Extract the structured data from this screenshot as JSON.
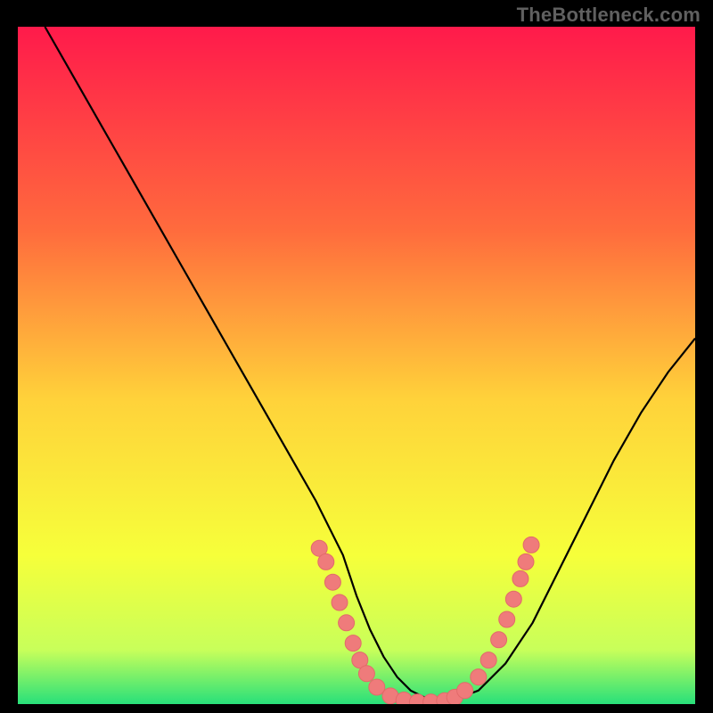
{
  "watermark": "TheBottleneck.com",
  "colors": {
    "background": "#000000",
    "grad_top": "#ff1a4b",
    "grad_mid1": "#ff6b3d",
    "grad_mid2": "#ffd23a",
    "grad_low1": "#f6ff3a",
    "grad_low2": "#c8ff5a",
    "grad_bottom": "#28e07a",
    "curve": "#000000",
    "marker_fill": "#ef7b7b",
    "marker_stroke": "#e26a6a"
  },
  "chart_data": {
    "type": "line",
    "title": "",
    "xlabel": "",
    "ylabel": "",
    "xlim": [
      0,
      100
    ],
    "ylim": [
      0,
      100
    ],
    "x": [
      4,
      8,
      12,
      16,
      20,
      24,
      28,
      32,
      36,
      40,
      44,
      48,
      50,
      52,
      54,
      56,
      58,
      60,
      62,
      64,
      68,
      72,
      76,
      80,
      84,
      88,
      92,
      96,
      100
    ],
    "values": [
      100,
      93,
      86,
      79,
      72,
      65,
      58,
      51,
      44,
      37,
      30,
      22,
      16,
      11,
      7,
      4,
      2,
      1,
      0.3,
      0.5,
      2,
      6,
      12,
      20,
      28,
      36,
      43,
      49,
      54
    ],
    "markers": [
      {
        "x": 44.5,
        "y": 23
      },
      {
        "x": 45.5,
        "y": 21
      },
      {
        "x": 46.5,
        "y": 18
      },
      {
        "x": 47.5,
        "y": 15
      },
      {
        "x": 48.5,
        "y": 12
      },
      {
        "x": 49.5,
        "y": 9
      },
      {
        "x": 50.5,
        "y": 6.5
      },
      {
        "x": 51.5,
        "y": 4.5
      },
      {
        "x": 53,
        "y": 2.5
      },
      {
        "x": 55,
        "y": 1.2
      },
      {
        "x": 57,
        "y": 0.6
      },
      {
        "x": 59,
        "y": 0.3
      },
      {
        "x": 61,
        "y": 0.3
      },
      {
        "x": 63,
        "y": 0.5
      },
      {
        "x": 64.5,
        "y": 1.0
      },
      {
        "x": 66,
        "y": 2.0
      },
      {
        "x": 68,
        "y": 4.0
      },
      {
        "x": 69.5,
        "y": 6.5
      },
      {
        "x": 71,
        "y": 9.5
      },
      {
        "x": 72.2,
        "y": 12.5
      },
      {
        "x": 73.2,
        "y": 15.5
      },
      {
        "x": 74.2,
        "y": 18.5
      },
      {
        "x": 75,
        "y": 21
      },
      {
        "x": 75.8,
        "y": 23.5
      }
    ],
    "marker_radius_px": 9
  }
}
